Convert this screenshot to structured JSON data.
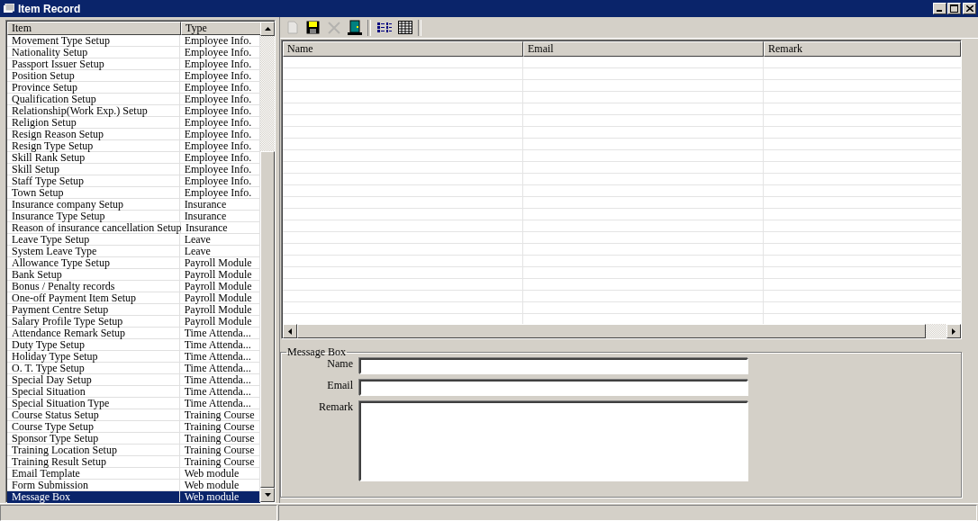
{
  "window": {
    "title": "Item Record"
  },
  "item_list": {
    "columns": [
      "Item",
      "Type"
    ],
    "rows": [
      {
        "item": "Movement Type Setup",
        "type": "Employee Info.",
        "selected": false
      },
      {
        "item": "Nationality Setup",
        "type": "Employee Info.",
        "selected": false
      },
      {
        "item": "Passport Issuer Setup",
        "type": "Employee Info.",
        "selected": false
      },
      {
        "item": "Position Setup",
        "type": "Employee Info.",
        "selected": false
      },
      {
        "item": "Province Setup",
        "type": "Employee Info.",
        "selected": false
      },
      {
        "item": "Qualification Setup",
        "type": "Employee Info.",
        "selected": false
      },
      {
        "item": "Relationship(Work Exp.) Setup",
        "type": "Employee Info.",
        "selected": false
      },
      {
        "item": "Religion Setup",
        "type": "Employee Info.",
        "selected": false
      },
      {
        "item": "Resign Reason Setup",
        "type": "Employee Info.",
        "selected": false
      },
      {
        "item": "Resign Type Setup",
        "type": "Employee Info.",
        "selected": false
      },
      {
        "item": "Skill Rank Setup",
        "type": "Employee Info.",
        "selected": false
      },
      {
        "item": "Skill Setup",
        "type": "Employee Info.",
        "selected": false
      },
      {
        "item": "Staff Type Setup",
        "type": "Employee Info.",
        "selected": false
      },
      {
        "item": "Town Setup",
        "type": "Employee Info.",
        "selected": false
      },
      {
        "item": "Insurance company Setup",
        "type": "Insurance",
        "selected": false
      },
      {
        "item": "Insurance Type Setup",
        "type": "Insurance",
        "selected": false
      },
      {
        "item": "Reason of insurance cancellation Setup",
        "type": "Insurance",
        "selected": false
      },
      {
        "item": "Leave Type Setup",
        "type": "Leave",
        "selected": false
      },
      {
        "item": "System Leave Type",
        "type": "Leave",
        "selected": false
      },
      {
        "item": "Allowance Type Setup",
        "type": "Payroll Module",
        "selected": false
      },
      {
        "item": "Bank Setup",
        "type": "Payroll Module",
        "selected": false
      },
      {
        "item": "Bonus / Penalty records",
        "type": "Payroll Module",
        "selected": false
      },
      {
        "item": "One-off Payment Item Setup",
        "type": "Payroll Module",
        "selected": false
      },
      {
        "item": "Payment Centre Setup",
        "type": "Payroll Module",
        "selected": false
      },
      {
        "item": "Salary Profile Type Setup",
        "type": "Payroll Module",
        "selected": false
      },
      {
        "item": "Attendance Remark Setup",
        "type": "Time Attenda...",
        "selected": false
      },
      {
        "item": "Duty Type Setup",
        "type": "Time Attenda...",
        "selected": false
      },
      {
        "item": "Holiday Type Setup",
        "type": "Time Attenda...",
        "selected": false
      },
      {
        "item": "O. T. Type Setup",
        "type": "Time Attenda...",
        "selected": false
      },
      {
        "item": "Special Day Setup",
        "type": "Time Attenda...",
        "selected": false
      },
      {
        "item": "Special Situation",
        "type": "Time Attenda...",
        "selected": false
      },
      {
        "item": "Special Situation Type",
        "type": "Time Attenda...",
        "selected": false
      },
      {
        "item": "Course Status Setup",
        "type": "Training Course",
        "selected": false
      },
      {
        "item": "Course Type Setup",
        "type": "Training Course",
        "selected": false
      },
      {
        "item": "Sponsor Type Setup",
        "type": "Training Course",
        "selected": false
      },
      {
        "item": "Training Location Setup",
        "type": "Training Course",
        "selected": false
      },
      {
        "item": "Training Result Setup",
        "type": "Training Course",
        "selected": false
      },
      {
        "item": "Email Template",
        "type": "Web module",
        "selected": false
      },
      {
        "item": "Form Submission",
        "type": "Web module",
        "selected": false
      },
      {
        "item": "Message Box",
        "type": "Web module",
        "selected": true
      }
    ]
  },
  "toolbar": [
    {
      "kind": "new",
      "disabled": true
    },
    {
      "kind": "save",
      "disabled": false
    },
    {
      "kind": "delete",
      "disabled": true
    },
    {
      "kind": "exit",
      "disabled": false
    },
    {
      "kind": "list",
      "disabled": false
    },
    {
      "kind": "grid",
      "disabled": false
    }
  ],
  "record_grid": {
    "columns": [
      "Name",
      "Email",
      "Remark"
    ]
  },
  "message_box": {
    "title": "Message Box",
    "fields": [
      {
        "label": "Name",
        "kind": "line"
      },
      {
        "label": "Email",
        "kind": "line"
      },
      {
        "label": "Remark",
        "kind": "area"
      }
    ]
  }
}
